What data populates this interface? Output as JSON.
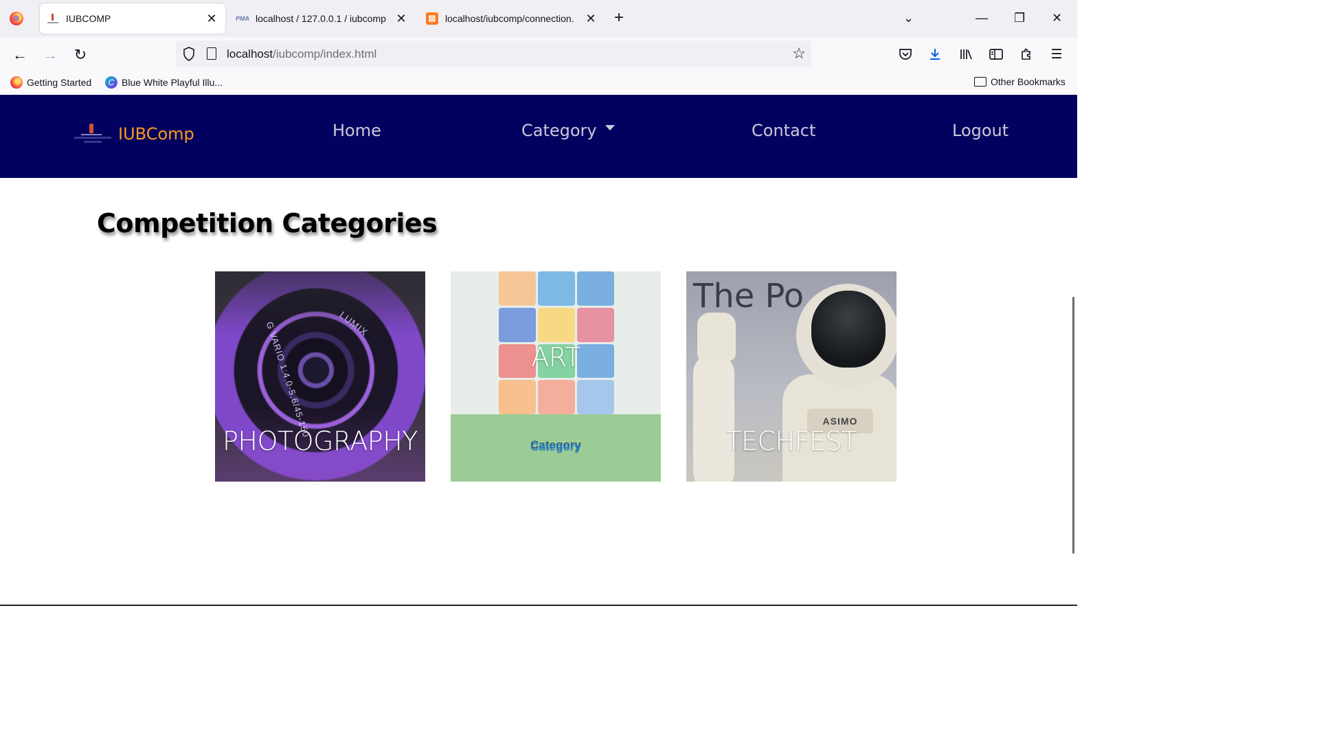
{
  "browser": {
    "tabs": [
      {
        "title": "IUBCOMP",
        "active": true,
        "favicon": "iub-favicon"
      },
      {
        "title": "localhost / 127.0.0.1 / iubcomp",
        "active": false,
        "favicon": "phpmyadmin-favicon"
      },
      {
        "title": "localhost/iubcomp/connection.",
        "active": false,
        "favicon": "xampp-favicon"
      }
    ],
    "url_host": "localhost",
    "url_path": "/iubcomp/index.html",
    "bookmarks": [
      {
        "label": "Getting Started",
        "icon": "firefox-icon"
      },
      {
        "label": "Blue White Playful Illu...",
        "icon": "canva-icon"
      }
    ],
    "other_bookmarks": "Other Bookmarks"
  },
  "site": {
    "brand": "IUBComp",
    "nav": {
      "home": "Home",
      "category": "Category",
      "contact": "Contact",
      "logout": "Logout"
    },
    "section_title": "Competition Categories",
    "cards": [
      {
        "caption": "PHOTOGRAPHY"
      },
      {
        "caption": "ART",
        "overlay_label": "Category"
      },
      {
        "caption": "TECHFEST"
      }
    ]
  },
  "colors": {
    "nav_bg": "#03015f",
    "brand": "#ff9a1a",
    "nav_link": "#c9c9d9",
    "art_panel": "#9bcc96"
  }
}
